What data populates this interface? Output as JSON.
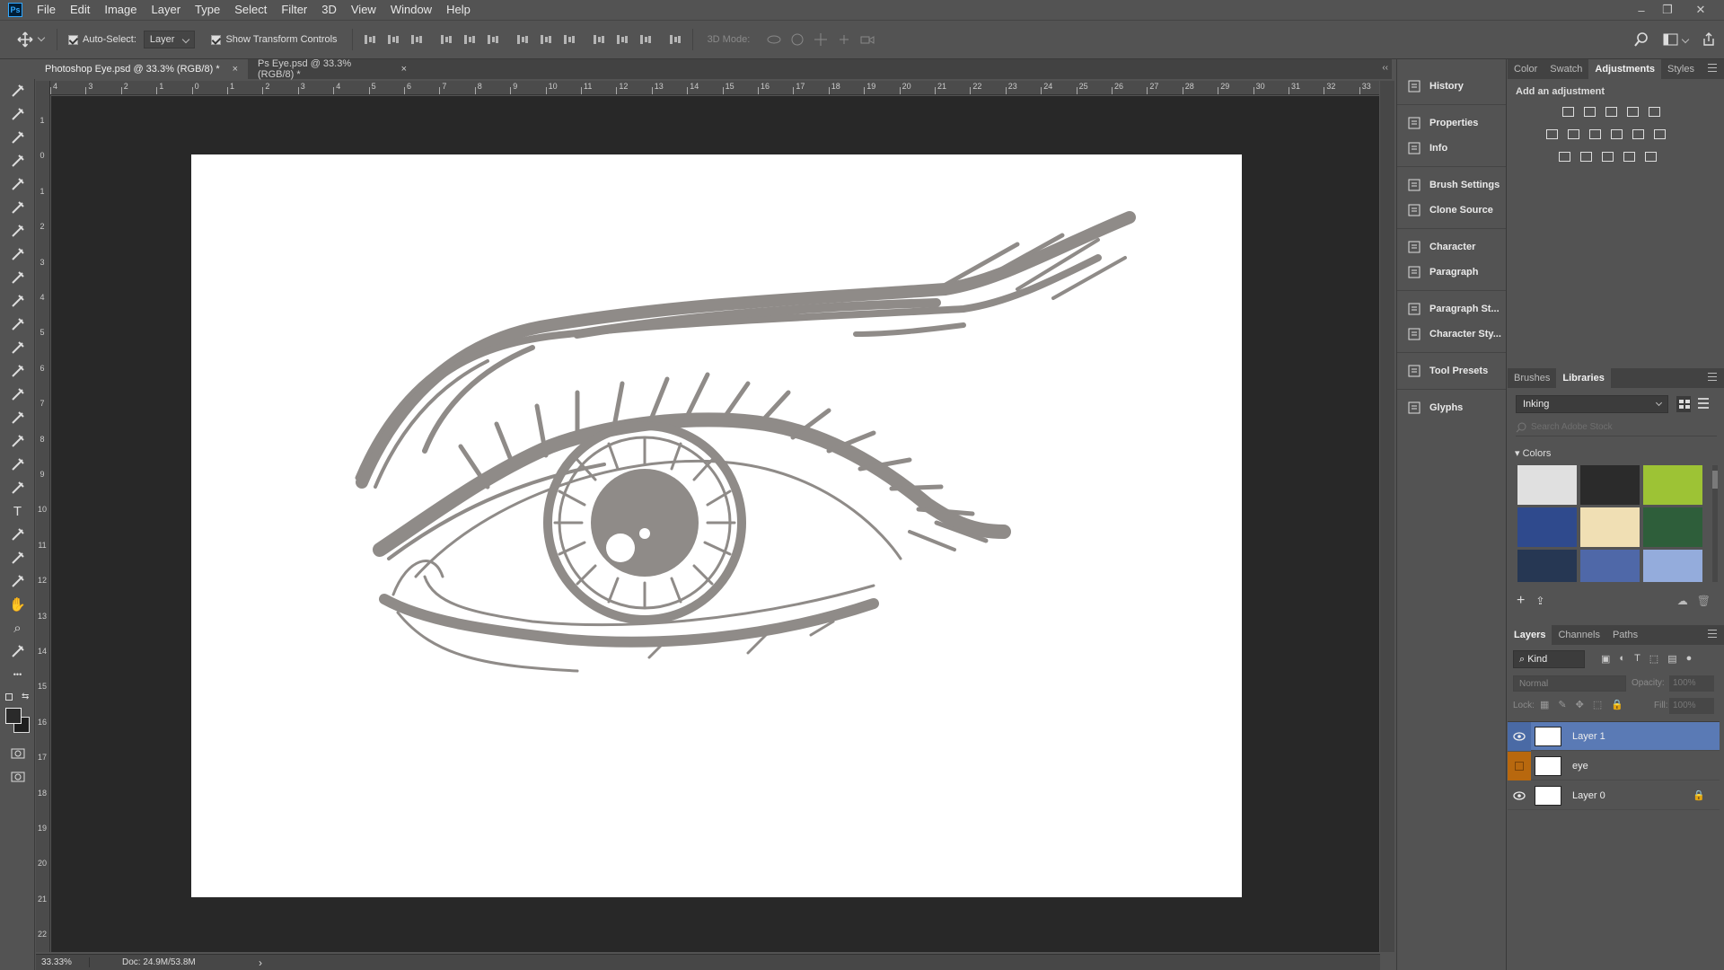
{
  "app": {
    "logo": "Ps"
  },
  "menu": [
    "File",
    "Edit",
    "Image",
    "Layer",
    "Type",
    "Select",
    "Filter",
    "3D",
    "View",
    "Window",
    "Help"
  ],
  "window_controls": {
    "minimize": "–",
    "restore": "❐",
    "close": "✕"
  },
  "options_bar": {
    "auto_select_label": "Auto-Select:",
    "auto_select_value": "Layer",
    "transform_controls_label": "Show Transform Controls",
    "mode_label": "3D Mode:"
  },
  "tabs": [
    {
      "label": "Photoshop Eye.psd @ 33.3% (RGB/8) *",
      "close": "×"
    },
    {
      "label": "Ps Eye.psd @ 33.3% (RGB/8) *",
      "close": "×"
    }
  ],
  "ruler_top": [
    "4",
    "3",
    "2",
    "1",
    "0",
    "1",
    "2",
    "3",
    "4",
    "5",
    "6",
    "7",
    "8",
    "9",
    "10",
    "11",
    "12",
    "13",
    "14",
    "15",
    "16",
    "17",
    "18",
    "19",
    "20",
    "21",
    "22",
    "23",
    "24",
    "25",
    "26",
    "27",
    "28",
    "29",
    "30",
    "31",
    "32",
    "33"
  ],
  "ruler_left": [
    "1",
    "0",
    "1",
    "2",
    "3",
    "4",
    "5",
    "6",
    "7",
    "8",
    "9",
    "10",
    "11",
    "12",
    "13",
    "14",
    "15",
    "16",
    "17",
    "18",
    "19",
    "20",
    "21",
    "22"
  ],
  "status": {
    "zoom": "33.33%",
    "doc": "Doc: 24.9M/53.8M",
    "arrow": "›"
  },
  "dock": [
    {
      "label": "History",
      "icon": "history-icon"
    },
    {
      "label": "Properties",
      "icon": "properties-icon"
    },
    {
      "label": "Info",
      "icon": "info-icon"
    },
    {
      "label": "Brush Settings",
      "icon": "brush-settings-icon"
    },
    {
      "label": "Clone Source",
      "icon": "clone-source-icon"
    },
    {
      "label": "Character",
      "icon": "character-icon"
    },
    {
      "label": "Paragraph",
      "icon": "paragraph-icon"
    },
    {
      "label": "Paragraph St...",
      "icon": "paragraph-styles-icon"
    },
    {
      "label": "Character Sty...",
      "icon": "character-styles-icon"
    },
    {
      "label": "Tool Presets",
      "icon": "tool-presets-icon"
    },
    {
      "label": "Glyphs",
      "icon": "glyphs-icon"
    }
  ],
  "adjustments_panel": {
    "tabs": [
      "Color",
      "Swatch",
      "Adjustments",
      "Styles"
    ],
    "active": "Adjustments",
    "heading": "Add an adjustment"
  },
  "libraries_panel": {
    "tabs": [
      "Brushes",
      "Libraries"
    ],
    "active": "Libraries",
    "library": "Inking",
    "search_placeholder": "Search Adobe Stock",
    "section": "Colors",
    "swatches": [
      "#e0e0e0",
      "#2b2b2b",
      "#9dc335",
      "#2f4a8d",
      "#f0dfb4",
      "#2e5e3a",
      "#263753",
      "#4f68a8",
      "#94acdc"
    ]
  },
  "layers_panel": {
    "tabs": [
      "Layers",
      "Channels",
      "Paths"
    ],
    "active": "Layers",
    "filter": "Kind",
    "blend_mode": "Normal",
    "opacity_label": "Opacity:",
    "opacity_value": "100%",
    "lock_label": "Lock:",
    "fill_label": "Fill:",
    "fill_value": "100%",
    "layers": [
      {
        "name": "Layer 1",
        "visible": true,
        "selected": true
      },
      {
        "name": "eye",
        "visible": false,
        "selected": false
      },
      {
        "name": "Layer 0",
        "visible": true,
        "selected": false,
        "locked": true
      }
    ]
  },
  "colors": {
    "accent": "#5a7ab5",
    "canvas_bg": "#282828",
    "ui_bg": "#535353",
    "ink": "#8f8b88",
    "orange": "#b8680e"
  }
}
